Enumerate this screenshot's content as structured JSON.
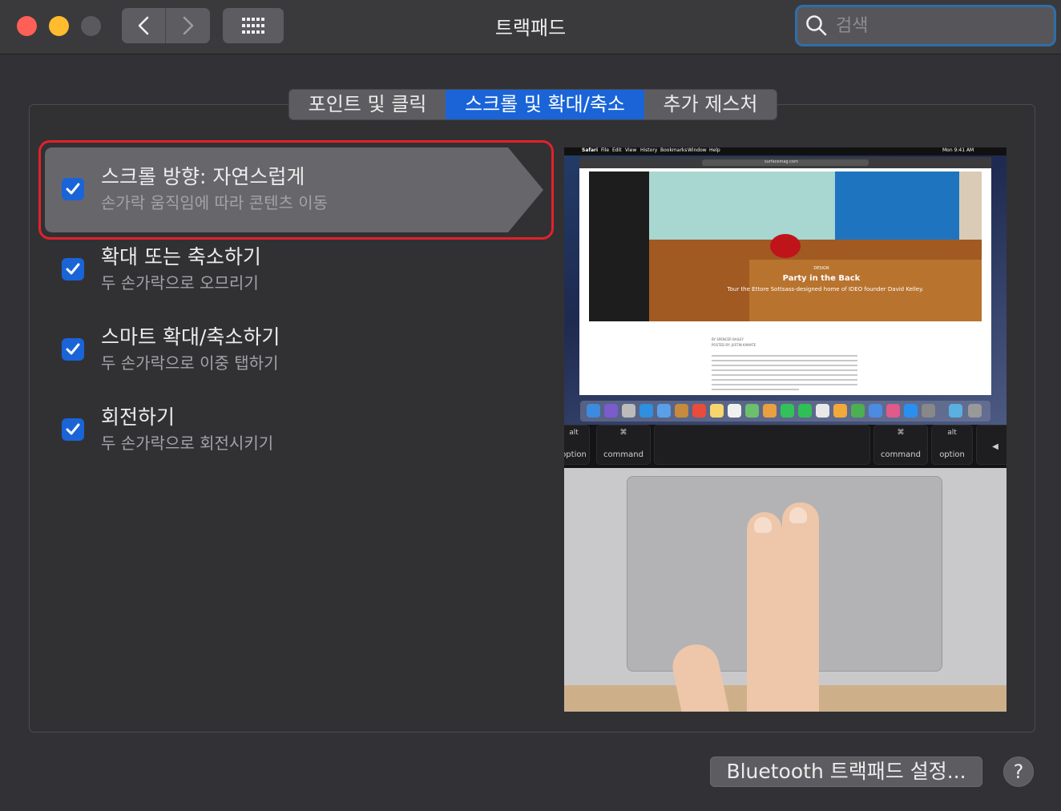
{
  "window": {
    "title": "트랙패드",
    "search_placeholder": "검색"
  },
  "tabs": [
    {
      "label": "포인트 및 클릭",
      "active": false
    },
    {
      "label": "스크롤 및 확대/축소",
      "active": true
    },
    {
      "label": "추가 제스처",
      "active": false
    }
  ],
  "options": [
    {
      "title": "스크롤 방향: 자연스럽게",
      "subtitle": "손가락 움직임에 따라 콘텐츠 이동",
      "checked": true,
      "selected": true
    },
    {
      "title": "확대 또는 축소하기",
      "subtitle": "두 손가락으로 오므리기",
      "checked": true,
      "selected": false
    },
    {
      "title": "스마트 확대/축소하기",
      "subtitle": "두 손가락으로 이중 탭하기",
      "checked": true,
      "selected": false
    },
    {
      "title": "회전하기",
      "subtitle": "두 손가락으로 회전시키기",
      "checked": true,
      "selected": false
    }
  ],
  "preview": {
    "menubar": {
      "app": "Safari",
      "items": [
        "File",
        "Edit",
        "View",
        "History",
        "Bookmarks",
        "Window",
        "Help"
      ],
      "clock": "Mon 9:41 AM"
    },
    "url": "surfacemag.com",
    "article_label": "DESIGN",
    "article_title": "Party in the Back",
    "article_subtitle": "Tour the Ettore Sottsass-designed home of IDEO founder David Kelley.",
    "byline": [
      "BY SPENCER BAILEY",
      "POSTED BY: JUSTIN KAMATE"
    ],
    "keys": [
      {
        "top": "alt",
        "bottom": "option"
      },
      {
        "top": "⌘",
        "bottom": "command"
      },
      {
        "top": "⌘",
        "bottom": "command"
      },
      {
        "top": "alt",
        "bottom": "option"
      },
      {
        "top": "",
        "bottom": "◀"
      }
    ]
  },
  "buttons": {
    "bluetooth": "Bluetooth 트랙패드 설정...",
    "help": "?"
  },
  "colors": {
    "accent": "#1a64d8",
    "highlight_ring": "#e3212a",
    "window_bg": "#323236"
  }
}
